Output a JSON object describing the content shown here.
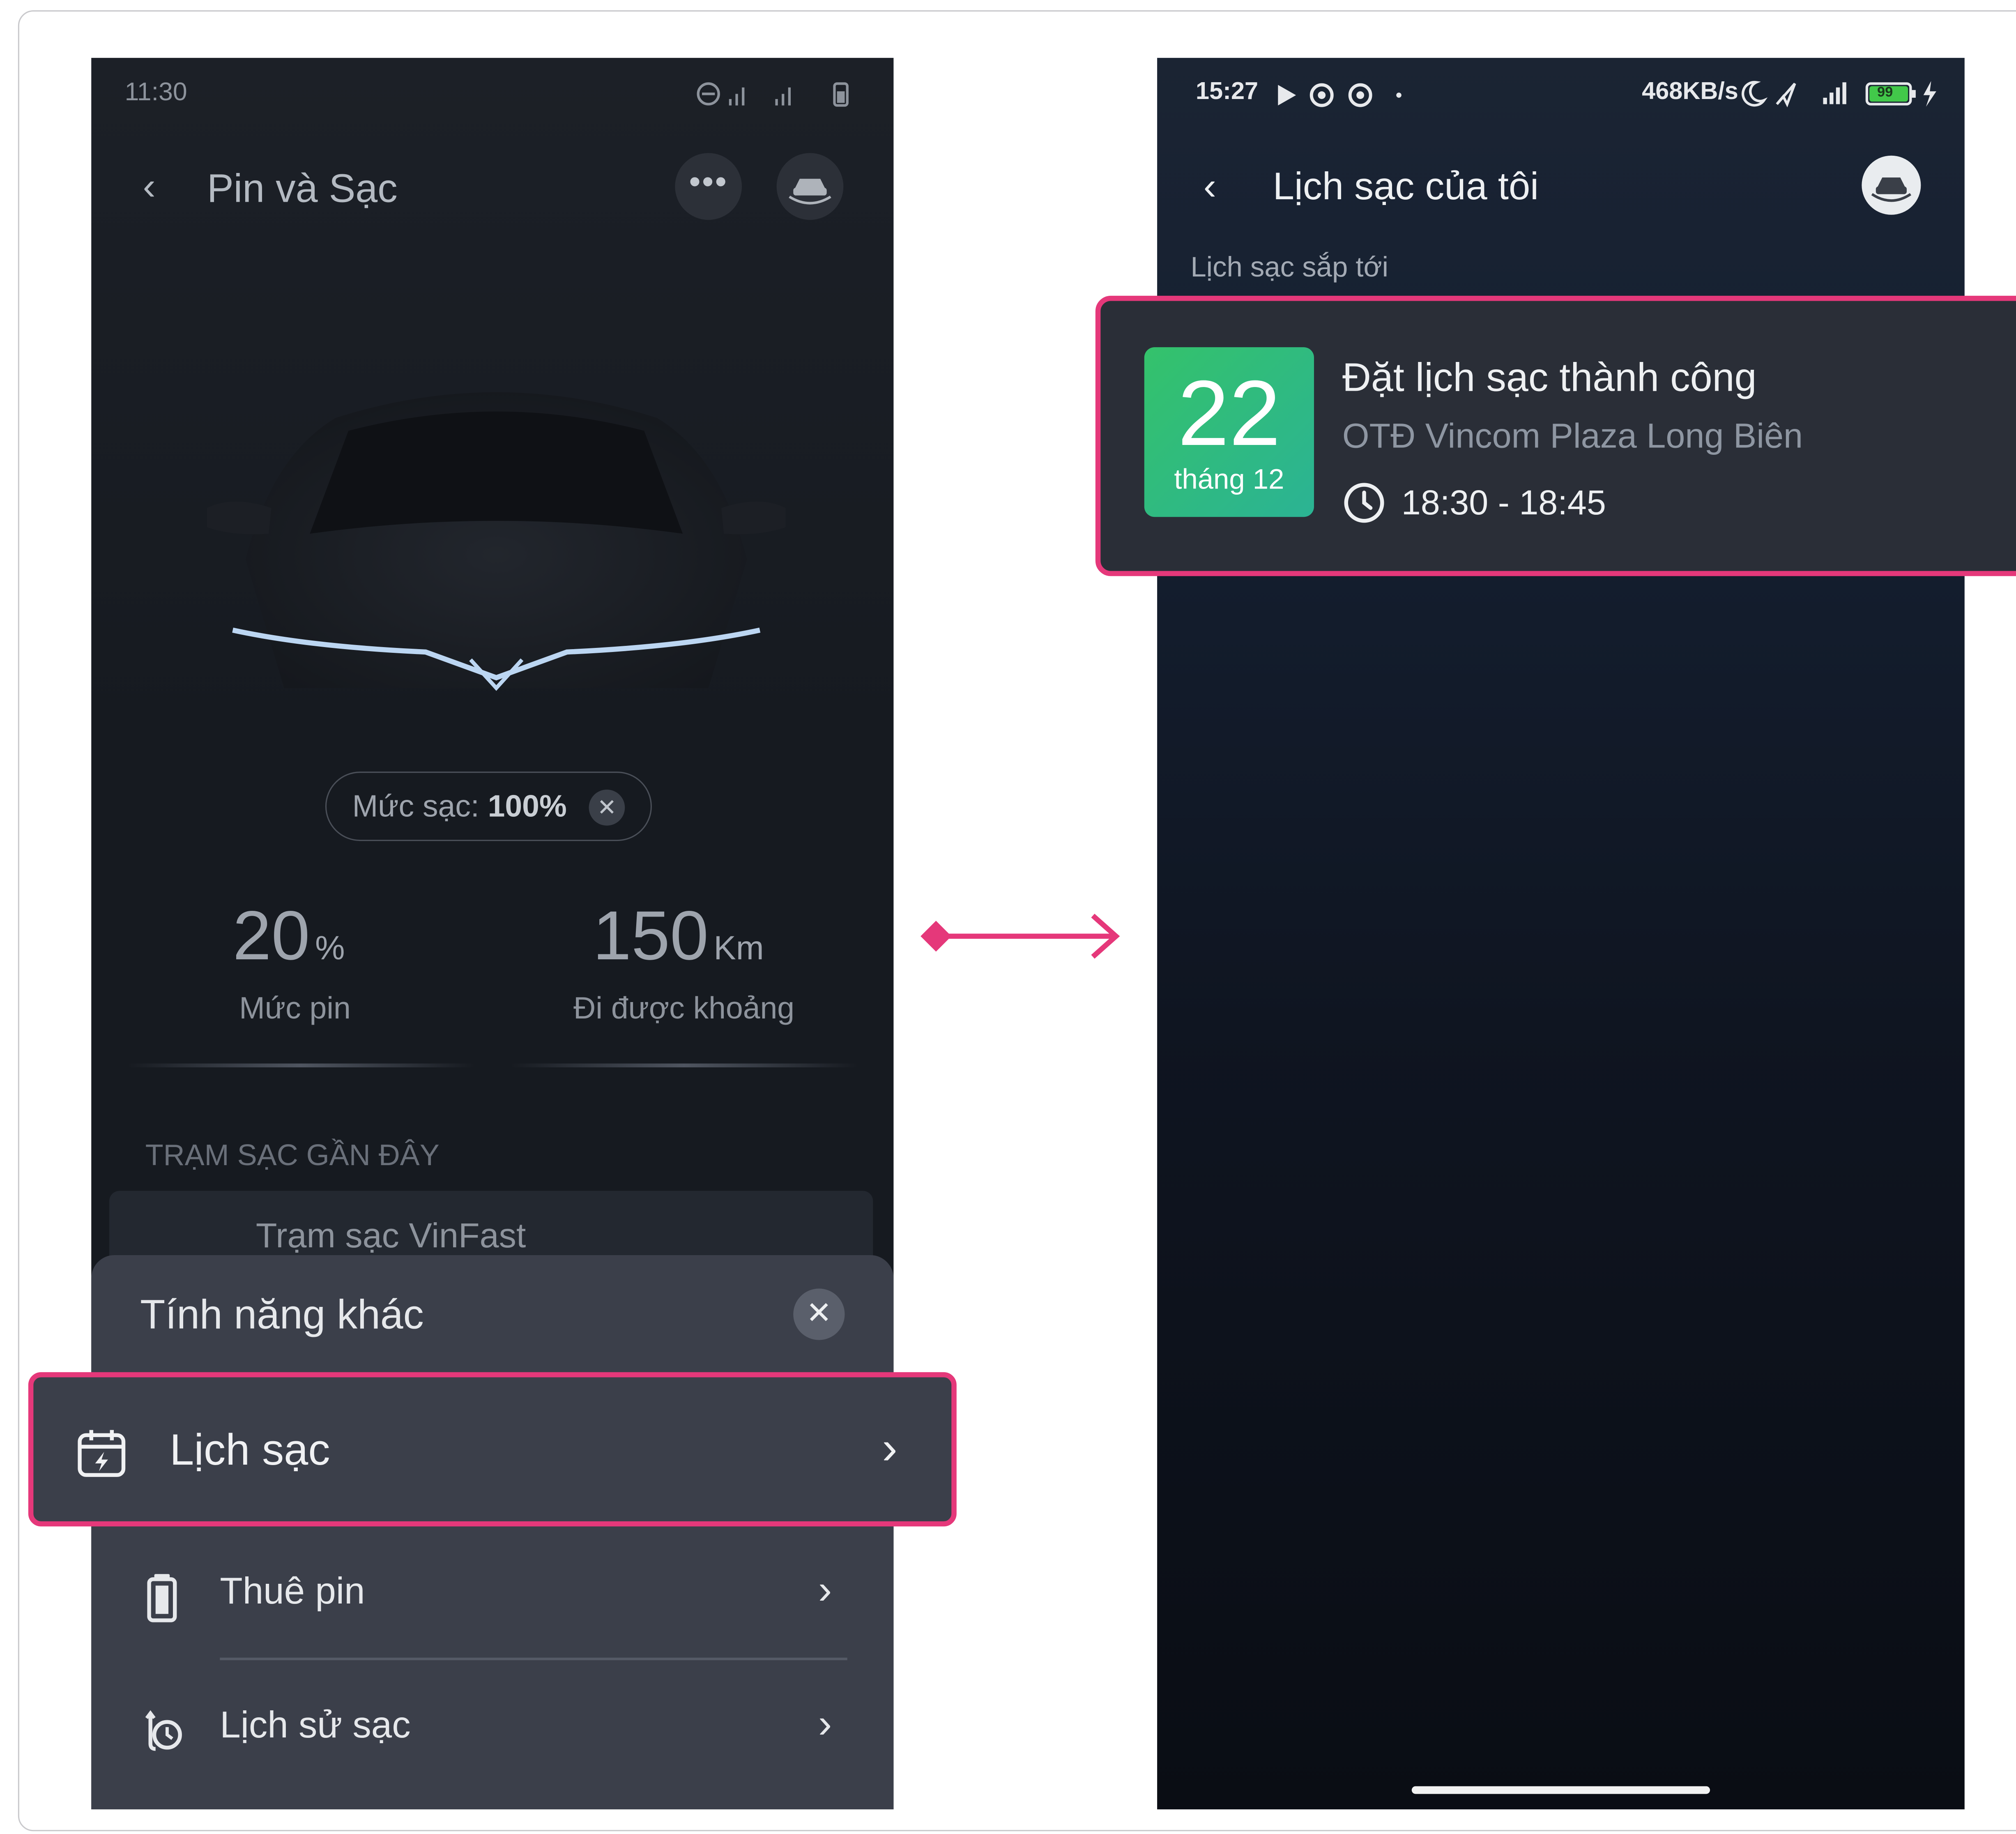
{
  "left_screen": {
    "status_time": "11:30",
    "title": "Pin và Sạc",
    "charge_chip": {
      "label": "Mức sạc:",
      "value": "100%"
    },
    "battery": {
      "value": "20",
      "unit": "%",
      "label": "Mức pin"
    },
    "range": {
      "value": "150",
      "unit": "Km",
      "label": "Đi được khoảng"
    },
    "nearby_section": "TRẠM SẠC GẦN ĐÂY",
    "station_name": "Trạm sạc VinFast",
    "sheet": {
      "title": "Tính năng khác",
      "items": [
        {
          "label": "Lịch sạc",
          "icon": "calendar-bolt-icon"
        },
        {
          "label": "Thuê pin",
          "icon": "battery-icon"
        },
        {
          "label": "Lịch sử sạc",
          "icon": "history-icon"
        }
      ]
    }
  },
  "right_screen": {
    "status_time": "15:27",
    "status_speed": "468KB/s",
    "battery_level": "99",
    "title": "Lịch sạc của tôi",
    "section": "Lịch sạc sắp tới",
    "schedule": {
      "day": "22",
      "month": "tháng 12",
      "title": "Đặt lịch sạc thành công",
      "location": "OTĐ Vincom Plaza Long Biên",
      "time": "18:30 - 18:45"
    }
  },
  "colors": {
    "highlight": "#e5387a",
    "date_gradient_start": "#34c26b",
    "date_gradient_end": "#2bb394",
    "arrow": "#e5387a"
  }
}
